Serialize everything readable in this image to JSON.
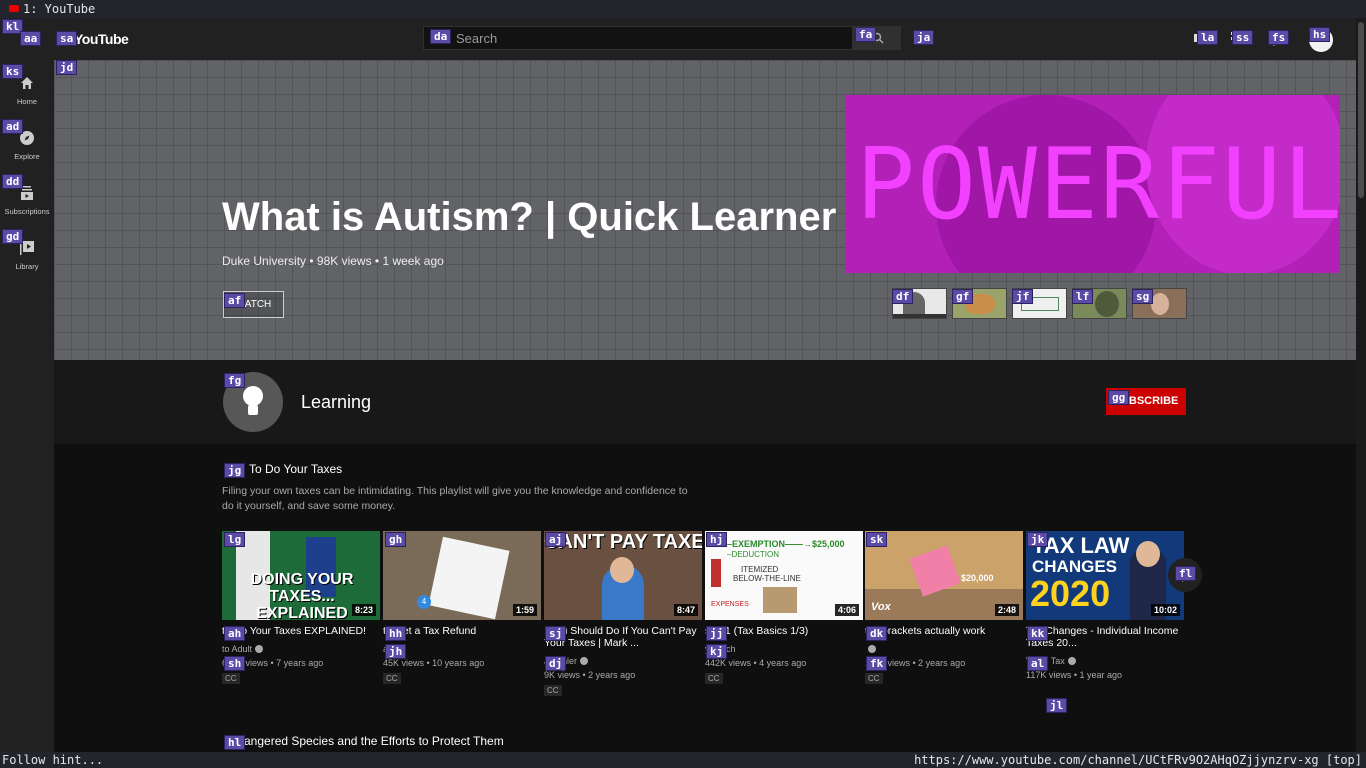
{
  "tab": {
    "title": "1: YouTube"
  },
  "masthead": {
    "logo": "YouTube",
    "search_placeholder": "Search"
  },
  "guide": [
    {
      "label": "Home",
      "icon": "home-icon"
    },
    {
      "label": "Explore",
      "icon": "compass-icon"
    },
    {
      "label": "Subscriptions",
      "icon": "subscriptions-icon"
    },
    {
      "label": "Library",
      "icon": "library-icon"
    }
  ],
  "featured": {
    "title": "What is Autism? | Quick Learner",
    "meta": "Duke University • 98K views • 1 week ago",
    "watch_label": "WATCH",
    "banner_text": "POWERFUL"
  },
  "channel": {
    "name": "Learning",
    "subscribe_label": "SUBSCRIBE"
  },
  "shelf": {
    "title": "To Do Your Taxes",
    "description": "Filing your own taxes can be intimidating. This playlist will give you the knowledge and confidence to do it yourself, and save some money.",
    "videos": [
      {
        "title": "to Do Your Taxes EXPLAINED!",
        "channel": "to Adult",
        "meta": "672K views • 7 years ago",
        "duration": "8:23",
        "cc": "CC"
      },
      {
        "title": "to Get a Tax Refund",
        "channel": "ast",
        "meta": "45K views • 10 years ago",
        "duration": "1:59",
        "cc": "CC"
      },
      {
        "title": ": You Should Do If You Can't Pay Your Taxes | Mark ...",
        "channel": "J Kohler",
        "meta": "9K views • 2 years ago",
        "duration": "8:47",
        "cc": "CC"
      },
      {
        "title": "s 101 (Tax Basics 1/3)",
        "channel": "yCoach",
        "meta": "442K views • 4 years ago",
        "duration": "4:06",
        "cc": "CC"
      },
      {
        "title": "tax brackets actually work",
        "channel": "",
        "meta": "1.6M views • 2 years ago",
        "duration": "2:48",
        "cc": "CC"
      },
      {
        "title": "Tax Changes - Individual Income Taxes 20...",
        "channel": "Value Tax",
        "meta": "117K views • 1 year ago",
        "duration": "10:02",
        "cc": ""
      }
    ]
  },
  "shelf2": {
    "title": "angered Species and the Efforts to Protect Them"
  },
  "thumb_text": {
    "t1": "DOING YOUR TAXES... EXPLAINED",
    "t3": "CAN'T PAY TAXES?",
    "t4a": "AGI–EXEMPTION——→$25,000",
    "t4b": "–DEDUCTION",
    "t4c": "ITEMIZED",
    "t4d": "BELOW-THE-LINE",
    "t4e": "EXPENSES",
    "t5a": "$20,000",
    "t5b": "Vox",
    "t6a": "TAX LAW",
    "t6b": "CHANGES",
    "t6c": "2020"
  },
  "status": {
    "left": "Follow hint...",
    "url": "https://www.youtube.com/channel/UCtFRv9O2AHqOZjjynzrv-xg [top]"
  },
  "hints": [
    "kl",
    "aa",
    "sa",
    "da",
    "fa",
    "ja",
    "la",
    "ss",
    "fs",
    "hs",
    "jd",
    "ks",
    "ad",
    "dd",
    "gd",
    "af",
    "df",
    "gf",
    "jf",
    "lf",
    "sg",
    "fg",
    "gg",
    "jg",
    "lg",
    "gh",
    "aj",
    "hj",
    "sk",
    "jk",
    "fl",
    "ah",
    "hh",
    "sj",
    "jj",
    "dk",
    "kk",
    "sh",
    "jh",
    "dj",
    "kj",
    "fk",
    "al",
    "jl",
    "hl"
  ]
}
